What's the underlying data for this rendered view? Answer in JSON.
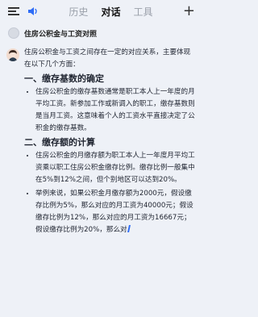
{
  "header": {
    "tabs": [
      {
        "label": "历史"
      },
      {
        "label": "对话"
      },
      {
        "label": "工具"
      }
    ],
    "plus": "+"
  },
  "conversation": {
    "title": "住房公积金与工资对照"
  },
  "message": {
    "intro": "住房公积金与工资之间存在一定的对应关系，主要体现在以下几个方面：",
    "sections": [
      {
        "heading": "一、缴存基数的确定",
        "bullets": [
          "住房公积金的缴存基数通常是职工本人上一年度的月平均工资。新参加工作或新调入的职工，缴存基数则是当月工资。这意味着个人的工资水平直接决定了公积金的缴存基数。"
        ]
      },
      {
        "heading": "二、缴存额的计算",
        "bullets": [
          "住房公积金的月缴存额为职工本人上一年度月平均工资乘以职工住房公积金缴存比例。缴存比例一般集中在5%到12%之间，但个别地区可以达到20%。",
          "举例来说，如果公积金月缴存额为2000元，假设缴存比例为5%，那么对应的月工资为40000元；假设缴存比例为12%，那么对应的月工资为16667元；假设缴存比例为20%，那么对"
        ]
      }
    ]
  }
}
